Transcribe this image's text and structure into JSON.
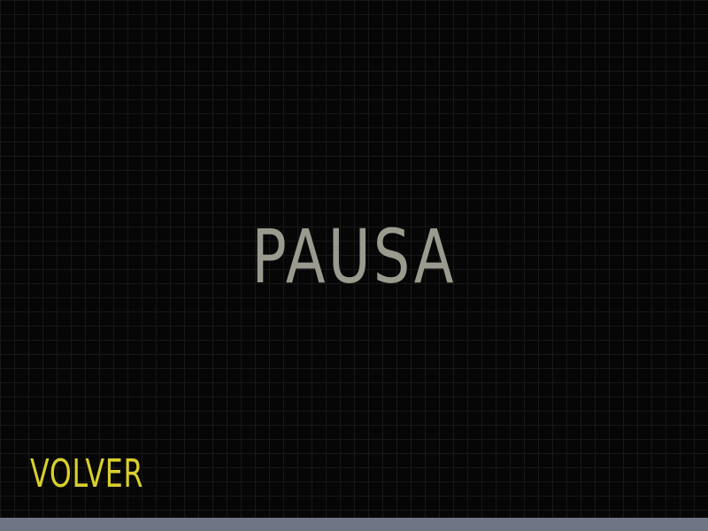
{
  "pause_screen": {
    "title": "PAUSA",
    "back_label": "VOLVER"
  },
  "colors": {
    "background": "#060606",
    "brick_mortar": "#181818",
    "title": "#9a9a8f",
    "back_button": "#d8cf2c",
    "bottom_bar": "#6f7584"
  }
}
